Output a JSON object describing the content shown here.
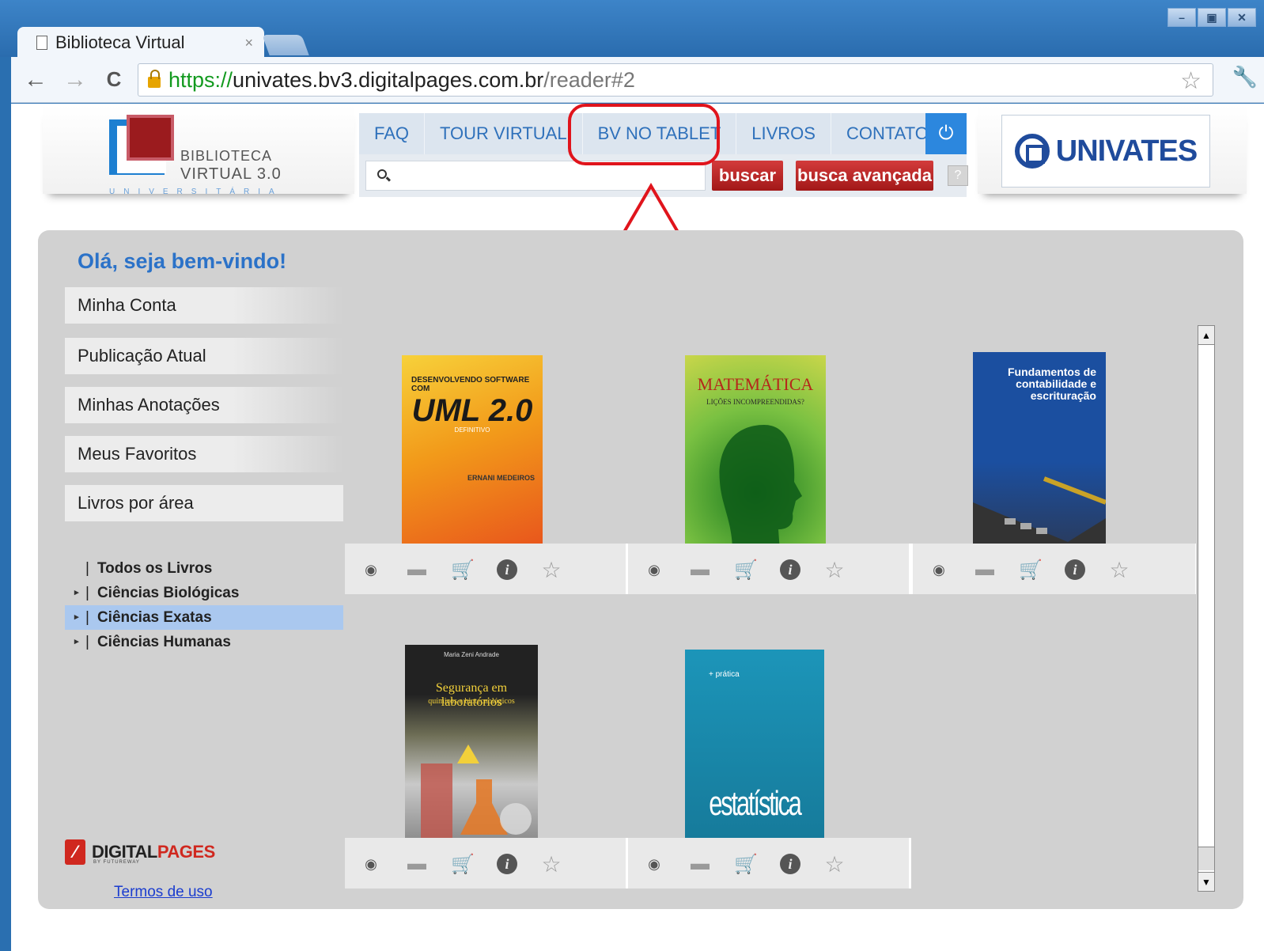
{
  "browser": {
    "tab_title": "Biblioteca Virtual",
    "tab_close": "×",
    "url_scheme": "https://",
    "url_host": "univates.bv3.digitalpages.com.br",
    "url_path": "/reader#2",
    "back": "←",
    "forward": "→",
    "reload": "C",
    "bookmark": "☆",
    "settings": "🔧",
    "window_controls": [
      "–",
      "▣",
      "✕"
    ]
  },
  "site": {
    "logo_line1": "BIBLIOTECA",
    "logo_line2": "VIRTUAL 3.0",
    "logo_line3": "UNIVERSITÁRIA",
    "menu": [
      "FAQ",
      "TOUR VIRTUAL",
      "BV NO TABLET",
      "LIVROS",
      "CONTATO"
    ],
    "power_icon": "⏻",
    "search_placeholder": "",
    "search_button": "buscar",
    "advanced_button": "busca avançada",
    "help": "?",
    "partner_name": "UNIVATES"
  },
  "sidebar": {
    "welcome": "Olá, seja bem-vindo!",
    "buttons": [
      "Minha Conta",
      "Publicação Atual",
      "Minhas Anotações",
      "Meus Favoritos",
      "Livros por área"
    ],
    "tree": [
      {
        "label": "Todos os Livros",
        "arrow": "",
        "selected": false
      },
      {
        "label": "Ciências Biológicas",
        "arrow": "▸",
        "selected": false
      },
      {
        "label": "Ciências Exatas",
        "arrow": "▸",
        "selected": true
      },
      {
        "label": "Ciências Humanas",
        "arrow": "▸",
        "selected": false
      }
    ],
    "footer_brand_a": "DIGITAL",
    "footer_brand_b": "PAGES",
    "footer_sub": "BY FUTUREWAY",
    "terms": "Termos de uso"
  },
  "books": [
    {
      "title_top": "DESENVOLVENDO SOFTWARE COM",
      "title_main": "UML 2.0",
      "title_sub": "DEFINITIVO",
      "author": "ERNANI MEDEIROS",
      "color": "#f0a020"
    },
    {
      "title_main": "MATEMÁTICA",
      "title_sub": "LIÇÕES INCOMPREENDIDAS?",
      "color": "#7cb342"
    },
    {
      "title_main": "Fundamentos de contabilidade e escrituração",
      "color": "#1b4fa0"
    },
    {
      "author": "Maria Zeni Andrade",
      "title_main": "Segurança em laboratórios",
      "title_sub": "químicos e biotecnológicos",
      "color": "#2a2a2a"
    },
    {
      "title_top": "+ prática",
      "title_main": "estatística",
      "color": "#1d8bb0"
    }
  ],
  "book_actions": [
    "view-icon",
    "print-icon",
    "cart-icon",
    "info-icon",
    "favorite-icon"
  ],
  "action_glyphs": {
    "view": "◉",
    "print": "▬",
    "cart": "🛒",
    "info": "i",
    "favorite": "☆"
  },
  "scroll_up": "▲",
  "scroll_down": "▼"
}
